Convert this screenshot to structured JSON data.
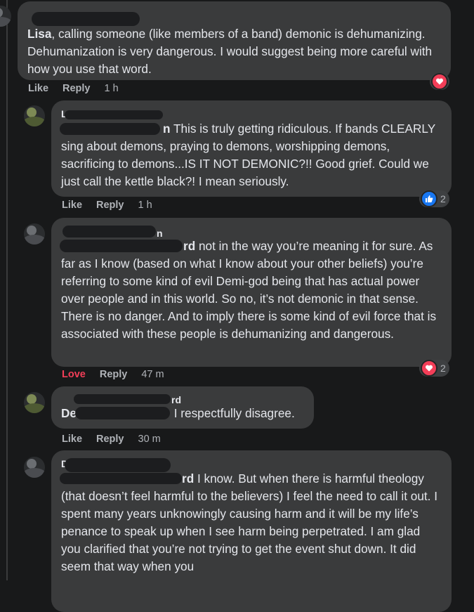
{
  "comments": [
    {
      "name": "",
      "tag": "Lisa",
      "body": ", calling someone (like members of a band) demonic is dehumanizing. Dehumanization is very dangerous. I would suggest being more careful with how you use that word.",
      "actions": {
        "like": "Like",
        "reply": "Reply",
        "time": "1 h"
      },
      "reactions": {
        "icon": "heart-icon",
        "count": ""
      }
    },
    {
      "name": "L                    d",
      "tag": "n",
      "body": " This is truly getting ridiculous. If bands CLEARLY sing about demons, praying to demons, worshipping demons, sacrificing to demons...IS IT NOT DEMONIC?!! Good grief. Could we just call the kettle black?! I mean seriously.",
      "actions": {
        "like": "Like",
        "reply": "Reply",
        "time": "1 h"
      },
      "reactions": {
        "icon": "like-icon",
        "count": "2"
      }
    },
    {
      "name": "n",
      "tag": "Li                                         rd",
      "body": " not in the way you’re meaning it for sure. As far as I know (based on what I know about your other beliefs) you’re referring to some kind of evil Demi-god being that has actual power over people and in this world. So no, it’s not demonic in that sense. There is no danger. And to imply there is some kind of evil force that is associated with these people is dehumanizing and dangerous.",
      "actions": {
        "like": "Love",
        "reply": "Reply",
        "time": "47 m"
      },
      "reactions": {
        "icon": "heart-icon",
        "count": "2"
      }
    },
    {
      "name": "rd",
      "tag": "De",
      "body": " I respectfully disagree.",
      "actions": {
        "like": "Like",
        "reply": "Reply",
        "time": "30 m"
      },
      "reactions": {
        "icon": "",
        "count": ""
      }
    },
    {
      "name": "D",
      "tag": "rd",
      "body": " I know. But when there is harmful theology (that doesn’t feel harmful to the believers) I feel the need to call it out. I spent many years unknowingly causing harm and it will be my life’s penance to speak up when I see harm being perpetrated. I am glad you clarified that you’re not trying to get the event shut down. It did seem that way when you",
      "actions": {
        "like": "",
        "reply": "",
        "time": ""
      },
      "reactions": {
        "icon": "",
        "count": ""
      }
    }
  ],
  "colors": {
    "background": "#18191a",
    "bubble": "#3a3b3c",
    "text": "#e4e6eb",
    "muted": "#b0b3b8",
    "love": "#f33e58",
    "like_blue": "#1877f2"
  }
}
